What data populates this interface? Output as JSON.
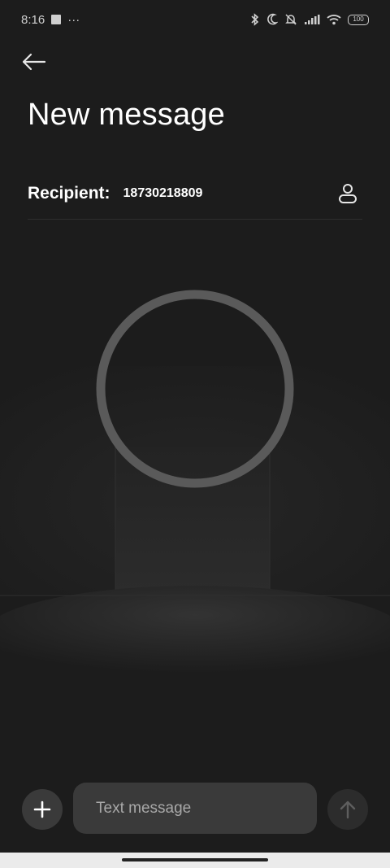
{
  "status_bar": {
    "time": "8:16",
    "more": "···",
    "battery": "100"
  },
  "header": {
    "title": "New message"
  },
  "recipient": {
    "label": "Recipient:",
    "value": "18730218809"
  },
  "composer": {
    "placeholder": "Text message"
  },
  "icons": {
    "back": "back-arrow-icon",
    "contact": "person-icon",
    "attach": "plus-icon",
    "send": "arrow-up-icon"
  },
  "colors": {
    "background": "#1c1c1c",
    "surface": "#3a3a3a",
    "text": "#ffffff",
    "placeholder": "#a8a8a8"
  }
}
